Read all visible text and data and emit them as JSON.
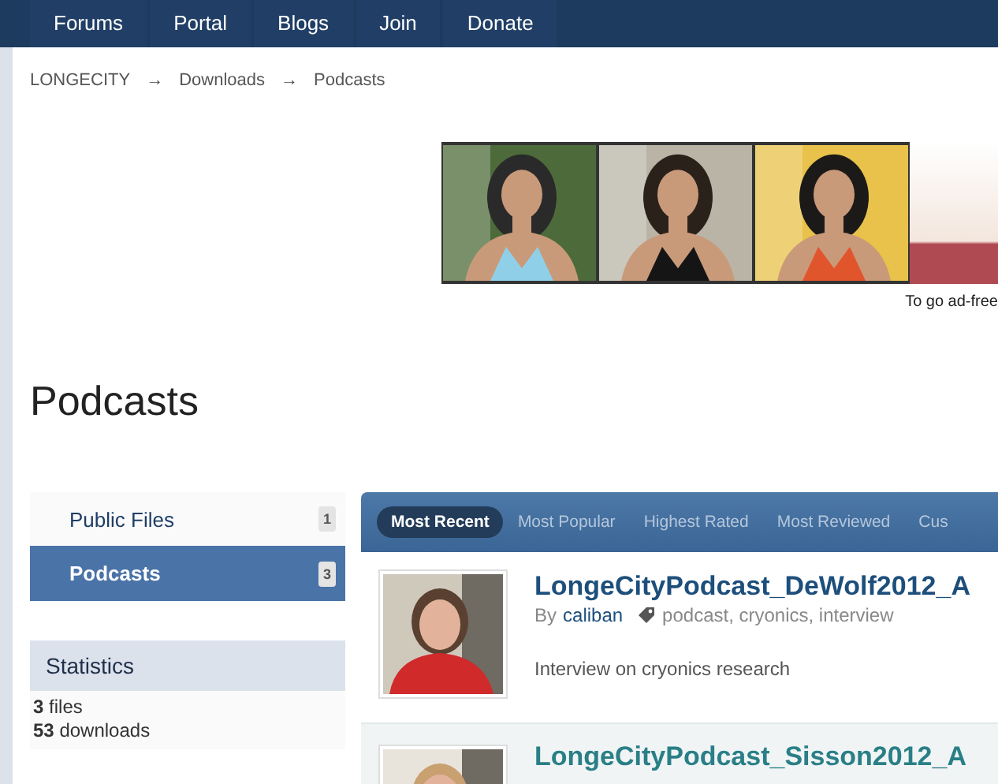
{
  "nav": [
    {
      "label": "Forums"
    },
    {
      "label": "Portal"
    },
    {
      "label": "Blogs"
    },
    {
      "label": "Join"
    },
    {
      "label": "Donate"
    }
  ],
  "breadcrumb": [
    {
      "kind": "link",
      "label": "LONGECITY"
    },
    {
      "kind": "separator",
      "label": "→"
    },
    {
      "kind": "link",
      "label": "Downloads"
    },
    {
      "kind": "separator",
      "label": "→"
    },
    {
      "kind": "link",
      "label": "Podcasts"
    }
  ],
  "ad": {
    "note": "To go ad-free"
  },
  "page_title": "Podcasts",
  "categories": [
    {
      "label": "Public Files",
      "count": "1",
      "selected": false
    },
    {
      "label": "Podcasts",
      "count": "3",
      "selected": true
    }
  ],
  "statistics": {
    "title": "Statistics",
    "lines": [
      "**3** files",
      "**53** downloads"
    ]
  },
  "tabs": [
    {
      "label": "Most Recent",
      "selected": true
    },
    {
      "label": "Most Popular",
      "selected": false
    },
    {
      "label": "Highest Rated",
      "selected": false
    },
    {
      "label": "Most Reviewed",
      "selected": false
    },
    {
      "label": "Cus",
      "selected": false
    }
  ],
  "files": [
    {
      "title": "LongeCityPodcast_DeWolf2012_A",
      "by": "By",
      "author": "caliban",
      "tags": "podcast, cryonics, interview",
      "description": "Interview on cryonics research"
    },
    {
      "title": "LongeCityPodcast_Sisson2012_A"
    }
  ]
}
